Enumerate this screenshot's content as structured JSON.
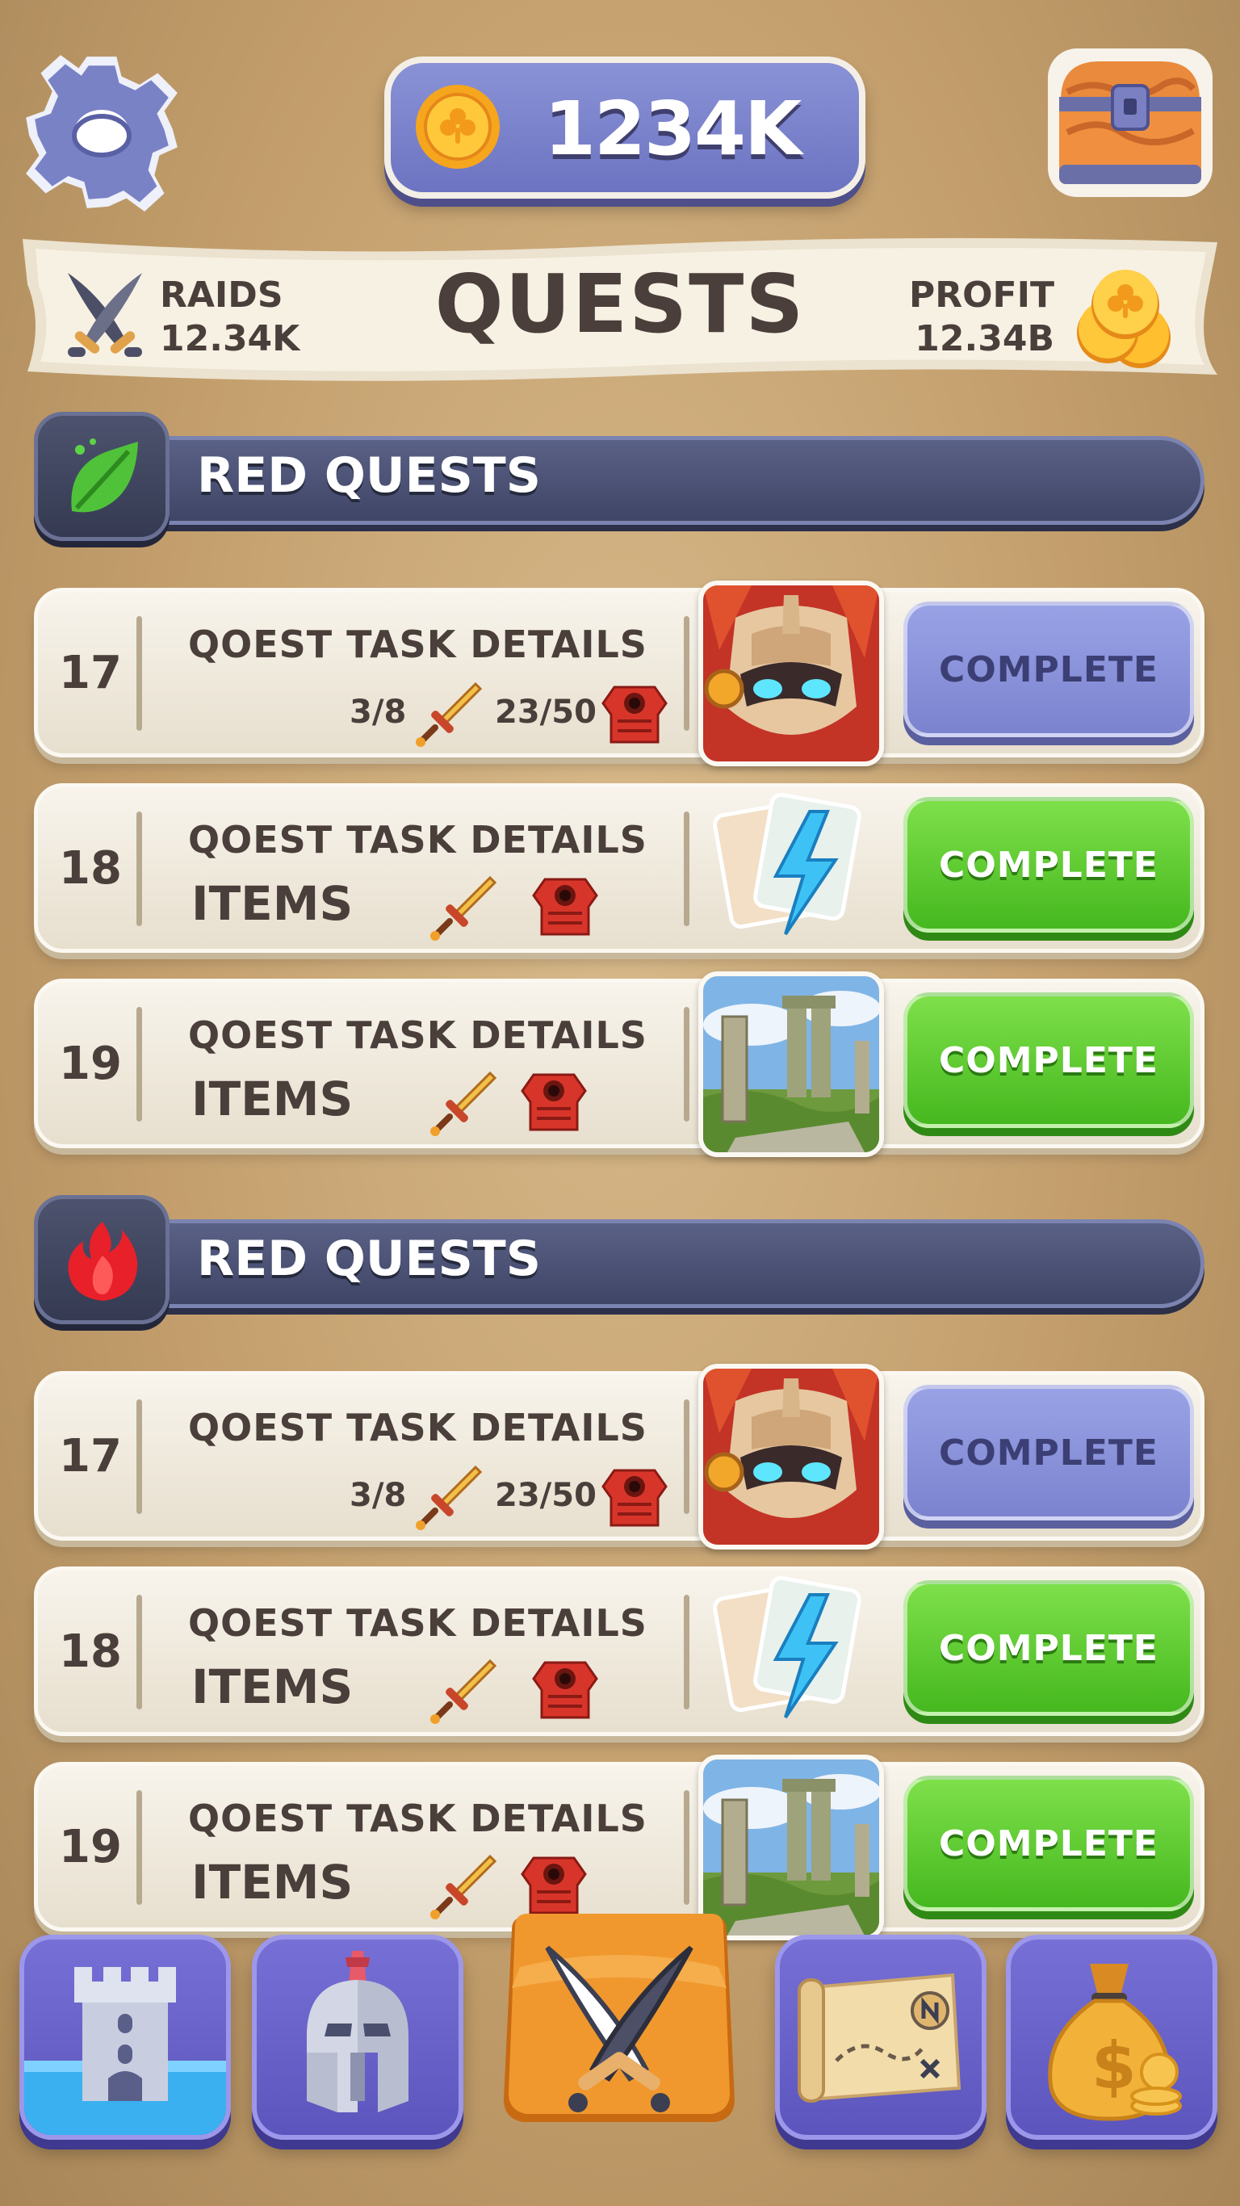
{
  "header": {
    "coin_amount": "1234K"
  },
  "banner": {
    "title": "QUESTS",
    "raids_label": "RAIDS",
    "raids_value": "12.34K",
    "profit_label": "PROFIT",
    "profit_value": "12.34B"
  },
  "sections": [
    {
      "title": "RED QUESTS",
      "icon": "leaf-icon",
      "quests": [
        {
          "number": "17",
          "title": "QOEST TASK DETAILS",
          "progress_sword": "3/8",
          "progress_armor": "23/50",
          "thumb": "warrior-portrait",
          "button": "COMPLETE",
          "button_state": "disabled"
        },
        {
          "number": "18",
          "title": "QOEST TASK DETAILS",
          "items_label": "ITEMS",
          "thumb": "lightning-cards",
          "button": "COMPLETE",
          "button_state": "ready"
        },
        {
          "number": "19",
          "title": "QOEST TASK DETAILS",
          "items_label": "ITEMS",
          "thumb": "ruins-landscape",
          "button": "COMPLETE",
          "button_state": "ready"
        }
      ]
    },
    {
      "title": "RED QUESTS",
      "icon": "fire-icon",
      "quests": [
        {
          "number": "17",
          "title": "QOEST TASK DETAILS",
          "progress_sword": "3/8",
          "progress_armor": "23/50",
          "thumb": "warrior-portrait",
          "button": "COMPLETE",
          "button_state": "disabled"
        },
        {
          "number": "18",
          "title": "QOEST TASK DETAILS",
          "items_label": "ITEMS",
          "thumb": "lightning-cards",
          "button": "COMPLETE",
          "button_state": "ready"
        },
        {
          "number": "19",
          "title": "QOEST TASK DETAILS",
          "items_label": "ITEMS",
          "thumb": "ruins-landscape",
          "button": "COMPLETE",
          "button_state": "ready"
        }
      ]
    }
  ],
  "bottom_nav": [
    {
      "icon": "castle-tower-icon"
    },
    {
      "icon": "spartan-helmet-icon"
    },
    {
      "icon": "crossed-swords-icon",
      "active": true
    },
    {
      "icon": "treasure-map-icon"
    },
    {
      "icon": "money-bag-icon"
    }
  ],
  "colors": {
    "background": "#c39e6c",
    "button_ready": "#4fbf22",
    "button_disabled": "#8088d4",
    "section_bar": "#4b5172",
    "nav_button": "#6a63cc",
    "nav_active": "#e8902a"
  }
}
